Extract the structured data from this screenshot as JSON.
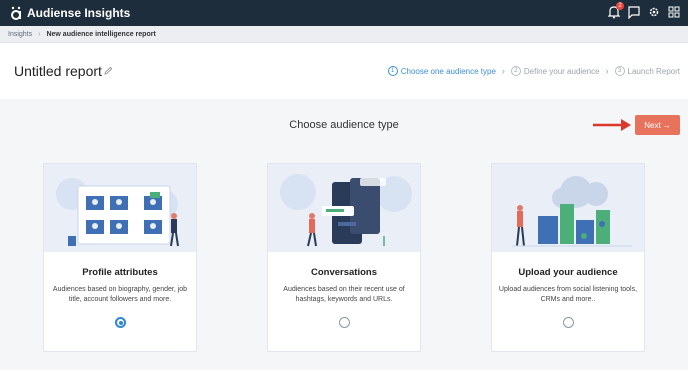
{
  "app": {
    "title": "Audiense Insights",
    "notification_count": "2"
  },
  "breadcrumb": {
    "items": [
      "Insights",
      "New audience intelligence report"
    ]
  },
  "header": {
    "title": "Untitled report"
  },
  "steps": [
    {
      "number": "1",
      "label": "Choose one audience type",
      "active": true
    },
    {
      "number": "2",
      "label": "Define your audience",
      "active": false
    },
    {
      "number": "3",
      "label": "Launch Report",
      "active": false
    }
  ],
  "main": {
    "section_title": "Choose audience type",
    "next_label": "Next"
  },
  "cards": [
    {
      "title": "Profile attributes",
      "description": "Audiences based on biography, gender, job title, account followers and more.",
      "selected": true
    },
    {
      "title": "Conversations",
      "description": "Audiences based on their recent use of hashtags, keywords and URLs.",
      "selected": false
    },
    {
      "title": "Upload your audience",
      "description": "Upload audiences from social listening tools, CRMs and more..",
      "selected": false
    }
  ],
  "colors": {
    "topbar": "#1e2d3b",
    "accent": "#3b8fd6",
    "next_button": "#e8735d",
    "arrow": "#d9382b"
  }
}
